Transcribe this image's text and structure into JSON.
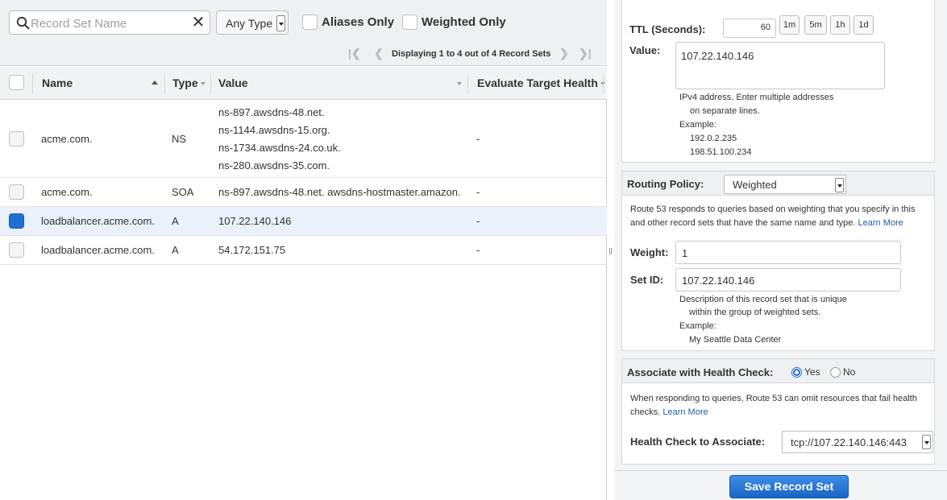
{
  "filter": {
    "search_placeholder": "Record Set Name",
    "type_select": "Any Type",
    "aliases_only": "Aliases Only",
    "weighted_only": "Weighted Only",
    "pager_text": "Displaying 1 to 4 out of 4 Record Sets"
  },
  "table": {
    "headers": [
      "Name",
      "Type",
      "Value",
      "Evaluate Target Health"
    ],
    "rows": [
      {
        "name": "acme.com.",
        "type": "NS",
        "values": [
          "ns-897.awsdns-48.net.",
          "ns-1144.awsdns-15.org.",
          "ns-1734.awsdns-24.co.uk.",
          "ns-280.awsdns-35.com."
        ],
        "eval": "-",
        "selected": false
      },
      {
        "name": "acme.com.",
        "type": "SOA",
        "values": [
          "ns-897.awsdns-48.net. awsdns-hostmaster.amazon."
        ],
        "eval": "-",
        "selected": false
      },
      {
        "name": "loadbalancer.acme.com.",
        "type": "A",
        "values": [
          "107.22.140.146"
        ],
        "eval": "-",
        "selected": true
      },
      {
        "name": "loadbalancer.acme.com.",
        "type": "A",
        "values": [
          "54.172.151.75"
        ],
        "eval": "-",
        "selected": false
      }
    ]
  },
  "ttl": {
    "label": "TTL (Seconds):",
    "value": "60",
    "buttons": [
      "1m",
      "5m",
      "1h",
      "1d"
    ]
  },
  "value_field": {
    "label": "Value:",
    "value": "107.22.140.146",
    "help": [
      "IPv4 address. Enter multiple addresses",
      "on separate lines.",
      "Example:",
      "192.0.2.235",
      "198.51.100.234"
    ]
  },
  "routing": {
    "label": "Routing Policy:",
    "selected": "Weighted",
    "description_1": "Route 53 responds to queries based on weighting that you specify in this",
    "description_2": "and other record sets that have the same name and type.",
    "learn_more": "Learn More",
    "weight_label": "Weight:",
    "weight_value": "1",
    "setid_label": "Set ID:",
    "setid_value": "107.22.140.146",
    "setid_help": [
      "Description of this record set that is unique",
      "within the group of weighted sets.",
      "Example:",
      "My Seattle Data Center"
    ]
  },
  "health": {
    "label": "Associate with Health Check:",
    "yes": "Yes",
    "no": "No",
    "description_1": "When responding to queries, Route 53 can omit resources that fail health",
    "description_2": "checks.",
    "learn_more": "Learn More",
    "check_label": "Health Check to Associate:",
    "check_value": "tcp://107.22.140.146:443"
  },
  "save_button": "Save Record Set"
}
